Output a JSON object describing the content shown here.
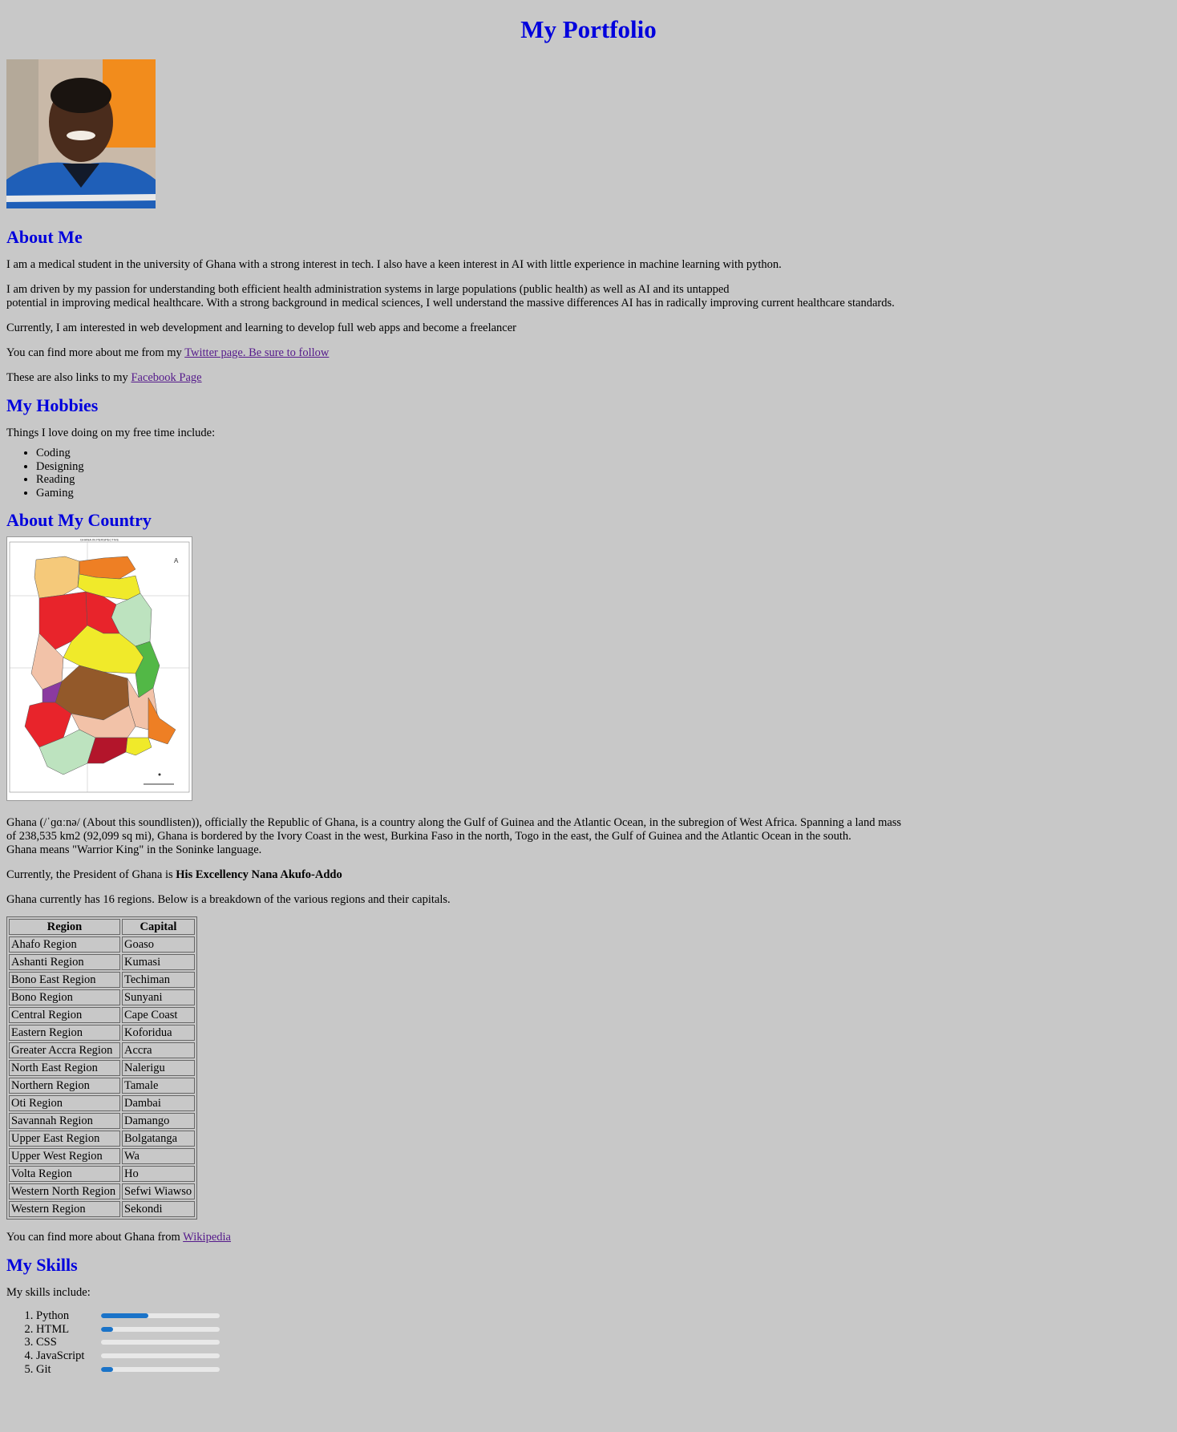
{
  "page": {
    "title": "My Portfolio"
  },
  "about": {
    "heading": "About Me",
    "p1": "I am a medical student in the university of Ghana with a strong interest in tech. I also have a keen interest in AI with little experience in machine learning with python.",
    "p2_line1": "I am driven by my passion for understanding both efficient health administration systems in large populations (public health) as well as AI and its untapped",
    "p2_line2": "potential in improving medical healthcare. With a strong background in medical sciences, I well understand the massive differences AI has in radically improving current healthcare standards.",
    "p3": "Currently, I am interested in web development and learning to develop full web apps and become a freelancer",
    "twitter_prefix": "You can find more about me from my ",
    "twitter_link": "Twitter page. Be sure to follow",
    "facebook_prefix": "These are also links to my ",
    "facebook_link": "Facebook Page"
  },
  "hobbies": {
    "heading": "My Hobbies",
    "intro": "Things I love doing on my free time include:",
    "items": [
      "Coding",
      "Designing",
      "Reading",
      "Gaming"
    ]
  },
  "country": {
    "heading": "About My Country",
    "map_title": "GHANA IN PERSPECTIVE",
    "desc_line1": "Ghana (/ˈɡɑːnə/ (About this soundlisten)), officially the Republic of Ghana, is a country along the Gulf of Guinea and the Atlantic Ocean, in the subregion of West Africa. Spanning a land mass",
    "desc_line2": "of 238,535 km2 (92,099 sq mi), Ghana is bordered by the Ivory Coast in the west, Burkina Faso in the north, Togo in the east, the Gulf of Guinea and the Atlantic Ocean in the south.",
    "desc_line3": "Ghana means \"Warrior King\" in the Soninke language.",
    "president_prefix": "Currently, the President of Ghana is ",
    "president_name": "His Excellency Nana Akufo-Addo",
    "regions_intro": "Ghana currently has 16 regions. Below is a breakdown of the various regions and their capitals.",
    "table": {
      "headers": [
        "Region",
        "Capital"
      ],
      "rows": [
        [
          "Ahafo Region",
          "Goaso"
        ],
        [
          "Ashanti Region",
          "Kumasi"
        ],
        [
          "Bono East Region",
          "Techiman"
        ],
        [
          "Bono Region",
          "Sunyani"
        ],
        [
          "Central Region",
          "Cape Coast"
        ],
        [
          "Eastern Region",
          "Koforidua"
        ],
        [
          "Greater Accra Region",
          "Accra"
        ],
        [
          "North East Region",
          "Nalerigu"
        ],
        [
          "Northern Region",
          "Tamale"
        ],
        [
          "Oti Region",
          "Dambai"
        ],
        [
          "Savannah Region",
          "Damango"
        ],
        [
          "Upper East Region",
          "Bolgatanga"
        ],
        [
          "Upper West Region",
          "Wa"
        ],
        [
          "Volta Region",
          "Ho"
        ],
        [
          "Western North Region",
          "Sefwi Wiawso"
        ],
        [
          "Western Region",
          "Sekondi"
        ]
      ]
    },
    "wiki_prefix": "You can find more about Ghana from ",
    "wiki_link": "Wikipedia"
  },
  "skills": {
    "heading": "My Skills",
    "intro": "My skills include:",
    "items": [
      {
        "label": "Python",
        "level": 0.4
      },
      {
        "label": "HTML",
        "level": 0.1
      },
      {
        "label": "CSS",
        "level": 0.0
      },
      {
        "label": "JavaScript",
        "level": 0.0
      },
      {
        "label": "Git",
        "level": 0.1
      }
    ]
  },
  "colors": {
    "background": "#c8c8c8",
    "heading": "#0000dd",
    "link_visited": "#551a8b",
    "bar_fill": "#1a73c8",
    "bar_track": "#e8e8e8"
  }
}
